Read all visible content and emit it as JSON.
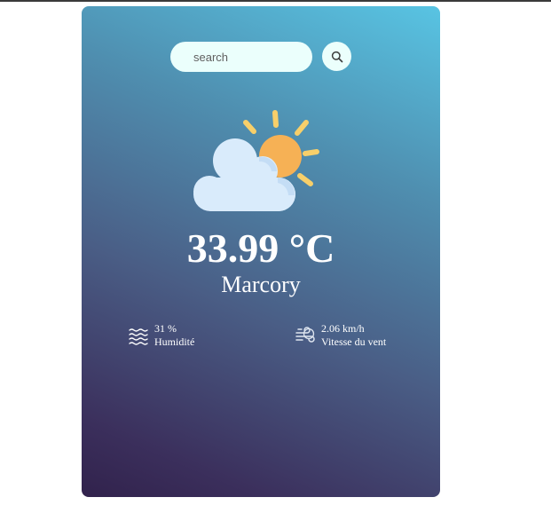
{
  "search": {
    "placeholder": "search",
    "value": ""
  },
  "weather": {
    "icon": "partly-cloudy-icon",
    "temperature": "33.99 °C",
    "city": "Marcory"
  },
  "details": {
    "humidity": {
      "icon": "humidity-waves-icon",
      "value": "31 %",
      "label": "Humidité"
    },
    "wind": {
      "icon": "wind-icon",
      "value": "2.06 km/h",
      "label": "Vitesse du vent"
    }
  },
  "colors": {
    "card_gradient_top": "#58c4e3",
    "card_gradient_bottom": "#31224c",
    "search_background": "#ebfffc",
    "sun": "#f6b155",
    "sun_rays": "#f7cf6a",
    "cloud": "#d9ebfb",
    "text": "#ffffff"
  }
}
